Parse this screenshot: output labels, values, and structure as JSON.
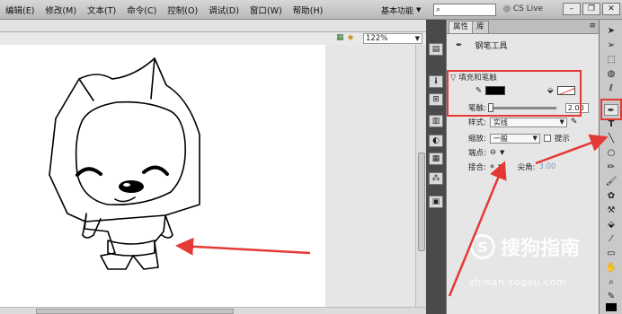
{
  "menu": {
    "items": [
      {
        "label": "编辑(E)"
      },
      {
        "label": "修改(M)"
      },
      {
        "label": "文本(T)"
      },
      {
        "label": "命令(C)"
      },
      {
        "label": "控制(O)"
      },
      {
        "label": "调试(D)"
      },
      {
        "label": "窗口(W)"
      },
      {
        "label": "帮助(H)"
      }
    ],
    "workspace_label": "基本功能",
    "cs_live_label": "CS Live"
  },
  "stage": {
    "zoom_value": "122%"
  },
  "panel": {
    "tabs": [
      {
        "label": "属性"
      },
      {
        "label": "库"
      }
    ],
    "tool_name": "钢笔工具",
    "section_title": "▽ 填充和笔触",
    "stroke_width_label": "笔触:",
    "stroke_width_value": "2.00",
    "style_label": "样式:",
    "style_value": "实线",
    "scale_label": "缩放:",
    "scale_value": "一般",
    "hint_label": "提示",
    "cap_label": "端点:",
    "join_label": "接合:",
    "miter_label": "尖角:",
    "miter_value": "3.00"
  },
  "watermark": {
    "brand": "搜狗指南",
    "url": "zhinan.sogou.com"
  },
  "colors": {
    "highlight": "#e53935",
    "stroke_color": "#000000"
  }
}
